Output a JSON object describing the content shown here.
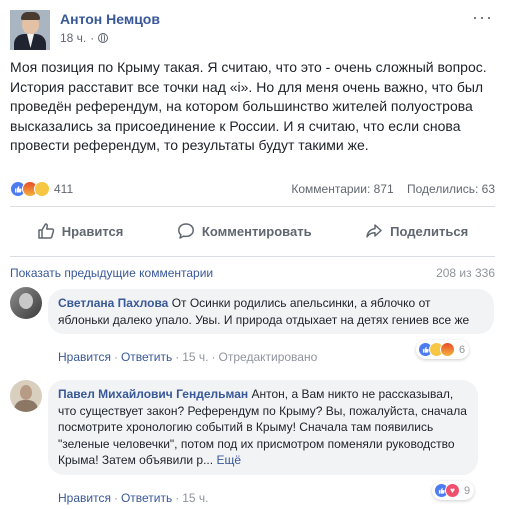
{
  "post": {
    "author": "Антон Немцов",
    "time": "18 ч.",
    "text": "Моя позиция по Крыму такая. Я считаю, что это - очень сложный вопрос. История расставит все точки над «і». Но для меня очень важно, что был проведён референдум, на котором большинство жителей полуострова высказались за присоединение к России. И я считаю, что если снова провести референдум, то результаты будут такими же.",
    "reactions_count": "411",
    "comments_label": "Комментарии: 871",
    "shares_label": "Поделились: 63",
    "reaction_icons": [
      "like-icon",
      "angry-icon",
      "wow-icon"
    ]
  },
  "actions": {
    "like": "Нравится",
    "comment": "Комментировать",
    "share": "Поделиться"
  },
  "comments_header": {
    "show_previous": "Показать предыдущие комментарии",
    "count": "208 из 336"
  },
  "comments": [
    {
      "author": "Светлана Пахлова",
      "text": "От Осинки родились апельсинки, а яблочко от яблоньки далеко упало. Увы. И природа отдыхает на детях гениев все же",
      "like": "Нравится",
      "reply": "Ответить",
      "time": "15 ч.",
      "edited": "Отредактировано",
      "reactions": "6"
    },
    {
      "author": "Павел Михайлович Гендельман",
      "text": "Антон, а Вам никто не рассказывал, что существует закон? Референдум по Крыму? Вы, пожалуйста, сначала посмотрите хронологию событий в Крыму! Сначала там появились \"зеленые человечки\", потом под их присмотром поменяли руководство Крыма! Затем объявили р...",
      "more": "Ещё",
      "like": "Нравится",
      "reply": "Ответить",
      "time": "15 ч.",
      "reactions": "9"
    }
  ],
  "colors": {
    "link": "#385898",
    "muted": "#616770",
    "bubble": "#f2f3f5",
    "like_reaction": "#4c7bf2"
  }
}
